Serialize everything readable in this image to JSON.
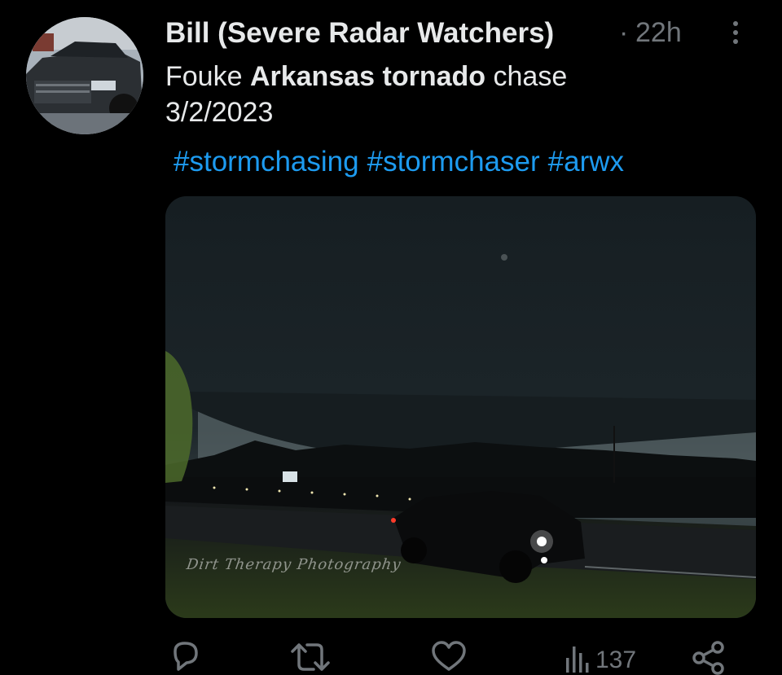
{
  "tweet": {
    "author_name": "Bill (Severe Radar Watchers)",
    "separator": "·",
    "time": "22h",
    "text_part1": "Fouke ",
    "text_bold1": "Arkansas",
    "text_space": " ",
    "text_bold2": "tornado",
    "text_part2": " chase",
    "text_line2": "3/2/2023",
    "hashtags": [
      "#stormchasing",
      "#stormchaser",
      "#arwx"
    ],
    "media_watermark": "Dirt Therapy Photography"
  },
  "actions": {
    "reply_icon": "reply-icon",
    "retweet_icon": "retweet-icon",
    "like_icon": "heart-icon",
    "views_icon": "views-icon",
    "views_count": "137",
    "share_icon": "share-icon"
  },
  "colors": {
    "background": "#000000",
    "text": "#e7e9ea",
    "muted": "#71767b",
    "link": "#1d9bf0"
  }
}
